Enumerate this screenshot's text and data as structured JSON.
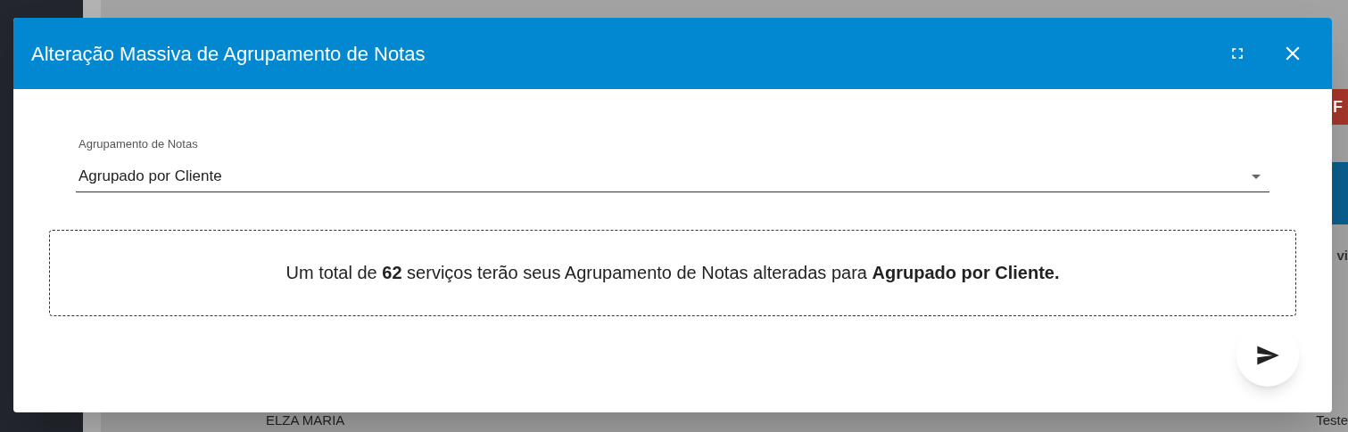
{
  "background": {
    "right_button": "F",
    "right_header": "vi",
    "right_row": "Teste",
    "bottom_row": "ELZA MARIA"
  },
  "dialog": {
    "title": "Alteração Massiva de Agrupamento de Notas",
    "field": {
      "label": "Agrupamento de Notas",
      "value": "Agrupado por Cliente"
    },
    "message": "Um total de **62** serviços terão seus Agrupamento de Notas alteradas para **Agrupado por Cliente.**"
  }
}
